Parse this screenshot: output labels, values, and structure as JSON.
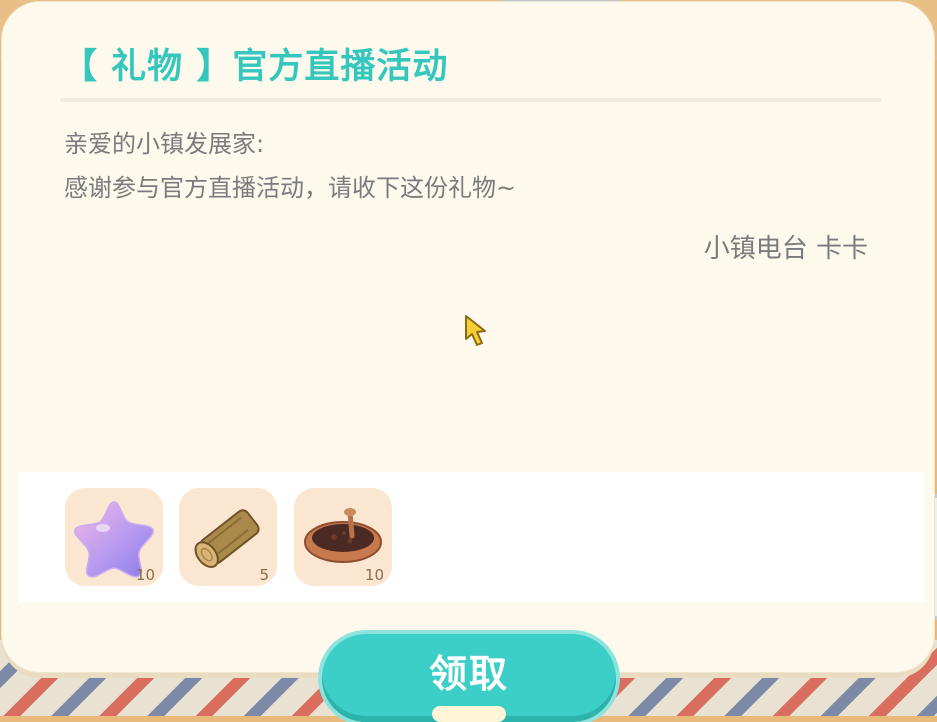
{
  "mail": {
    "title": "【 礼物 】官方直播活动",
    "greeting": "亲爱的小镇发展家:",
    "body": "感谢参与官方直播活动，请收下这份礼物~",
    "signature": "小镇电台 卡卡"
  },
  "rewards": [
    {
      "icon": "purple-star-icon",
      "quantity": "10"
    },
    {
      "icon": "wood-log-icon",
      "quantity": "5"
    },
    {
      "icon": "soil-pot-icon",
      "quantity": "10"
    }
  ],
  "claim_button": {
    "label": "领取"
  },
  "colors": {
    "accent": "#35c7be",
    "button": "#3ccfc7",
    "card": "#fdfaed",
    "text": "#7a7b7c",
    "item_bg": "#fbe6d2"
  }
}
